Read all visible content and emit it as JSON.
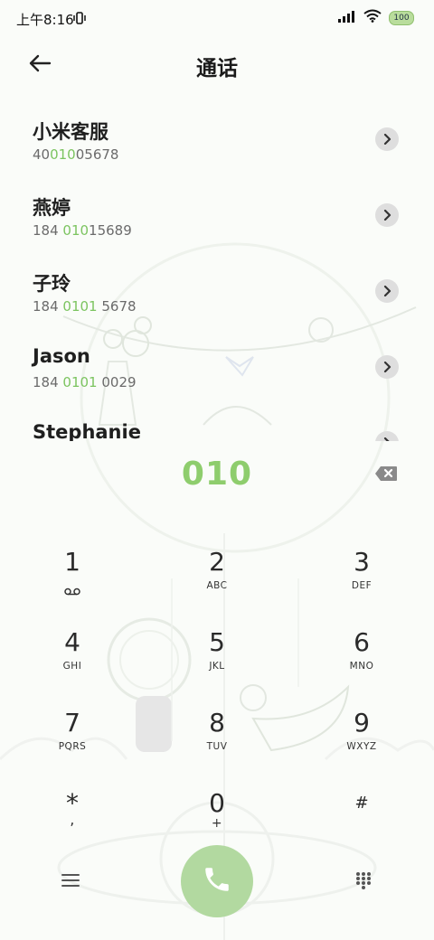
{
  "status_bar": {
    "time": "上午8:16",
    "battery": "100"
  },
  "header": {
    "title": "通话"
  },
  "contacts": [
    {
      "name": "小米客服",
      "num_pre": "40",
      "num_hl": "010",
      "num_post": "05678"
    },
    {
      "name": "燕婷",
      "num_pre": "184 ",
      "num_hl": "010",
      "num_post": "15689"
    },
    {
      "name": "子玲",
      "num_pre": "184 ",
      "num_hl": "0101",
      "num_post": " 5678"
    },
    {
      "name": "Jason",
      "num_pre": "184 ",
      "num_hl": "0101",
      "num_post": " 0029"
    },
    {
      "name": "Stephanie",
      "num_pre": "",
      "num_hl": "",
      "num_post": ""
    }
  ],
  "dialer": {
    "input": "010"
  },
  "keypad": [
    {
      "digit": "1",
      "sub": ""
    },
    {
      "digit": "2",
      "sub": "ABC"
    },
    {
      "digit": "3",
      "sub": "DEF"
    },
    {
      "digit": "4",
      "sub": "GHI"
    },
    {
      "digit": "5",
      "sub": "JKL"
    },
    {
      "digit": "6",
      "sub": "MNO"
    },
    {
      "digit": "7",
      "sub": "PQRS"
    },
    {
      "digit": "8",
      "sub": "TUV"
    },
    {
      "digit": "9",
      "sub": "WXYZ"
    },
    {
      "digit": "*",
      "sub": ","
    },
    {
      "digit": "0",
      "sub": "+"
    },
    {
      "digit": "#",
      "sub": ""
    }
  ],
  "colors": {
    "accent": "#8ecd6d",
    "highlight": "#7cc460",
    "call_button": "#b2d9a0"
  },
  "icons": {
    "back": "arrow-left-icon",
    "detail": "chevron-right-icon",
    "backspace": "backspace-icon",
    "voicemail": "voicemail-icon",
    "menu": "menu-icon",
    "call": "phone-icon",
    "keypad": "dialpad-icon"
  }
}
